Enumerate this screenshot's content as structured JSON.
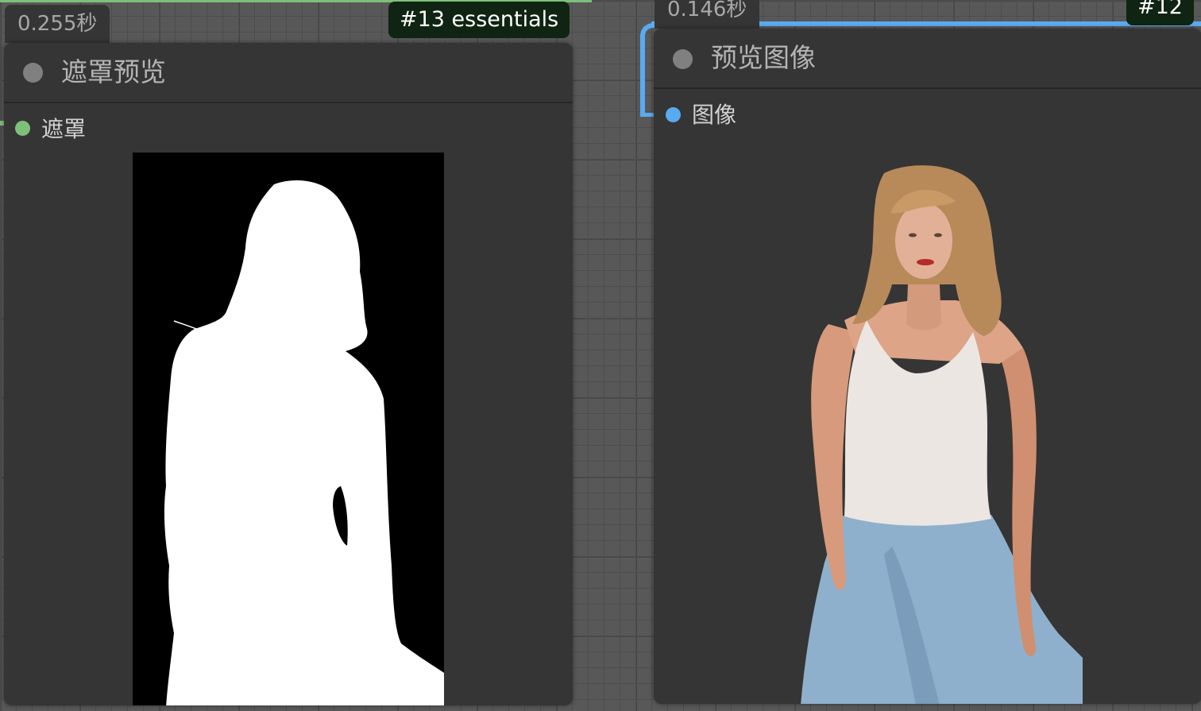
{
  "left_node": {
    "timing": "0.255秒",
    "id_badge": "#13 essentials",
    "title": "遮罩预览",
    "input_slot": "遮罩",
    "slot_color": "#7ec07a"
  },
  "right_node": {
    "timing": "0.146秒",
    "id_badge": "#12",
    "title": "预览图像",
    "input_slot": "图像",
    "slot_color": "#5aaaf0"
  },
  "colors": {
    "canvas_bg": "#585858",
    "node_bg": "#353535",
    "link_image": "#5aaaf0",
    "link_mask": "#7ec07a",
    "badge_bg": "#0f2412"
  }
}
